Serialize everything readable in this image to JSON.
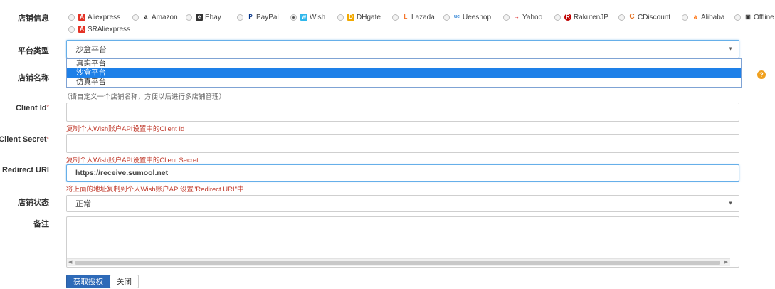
{
  "labels": {
    "store_info": "店铺信息",
    "platform_type": "平台类型",
    "store_name": "店铺名称",
    "client_id": "Client Id",
    "client_secret": "Client Secret",
    "redirect_uri": "Redirect URI",
    "store_status": "店铺状态",
    "remark": "备注",
    "required_mark": "*"
  },
  "platforms": [
    {
      "label": "Aliexpress",
      "icon": "aliexpress-icon",
      "checked": false
    },
    {
      "label": "Amazon",
      "icon": "amazon-icon",
      "checked": false
    },
    {
      "label": "Ebay",
      "icon": "ebay-icon",
      "checked": false
    },
    {
      "label": "PayPal",
      "icon": "paypal-icon",
      "checked": false
    },
    {
      "label": "Wish",
      "icon": "wish-icon",
      "checked": true
    },
    {
      "label": "DHgate",
      "icon": "dhgate-icon",
      "checked": false
    },
    {
      "label": "Lazada",
      "icon": "lazada-icon",
      "checked": false
    },
    {
      "label": "Ueeshop",
      "icon": "ueeshop-icon",
      "checked": false
    },
    {
      "label": "Yahoo",
      "icon": "yahoo-icon",
      "checked": false
    },
    {
      "label": "RakutenJP",
      "icon": "rakuten-icon",
      "checked": false
    },
    {
      "label": "CDiscount",
      "icon": "cdiscount-icon",
      "checked": false
    },
    {
      "label": "Alibaba",
      "icon": "alibaba-icon",
      "checked": false
    },
    {
      "label": "Offline",
      "icon": "offline-icon",
      "checked": false
    },
    {
      "label": "SRAliexpress",
      "icon": "sraliexpress-icon",
      "checked": false
    }
  ],
  "platform_select": {
    "value": "沙盒平台",
    "options": [
      "真实平台",
      "沙盒平台",
      "仿真平台"
    ],
    "highlighted_index": 1
  },
  "hints": {
    "store_name": "（请自定义一个店铺名称，方便以后进行多店铺管理）",
    "client_id": "复制个人Wish账户API设置中的Client Id",
    "client_secret": "复制个人Wish账户API设置中的Client Secret",
    "redirect_uri": "将上面的地址复制到个人Wish账户API设置\"Redirect URI\"中"
  },
  "redirect_uri_value": "https://receive.sumool.net",
  "store_status_value": "正常",
  "buttons": {
    "authorize": "获取授权",
    "close": "关闭"
  },
  "colors": {
    "primary_button": "#2e6ab8",
    "hint_red": "#c0392b",
    "dropdown_highlight": "#1e80e8",
    "help_icon": "#f0a01e"
  }
}
